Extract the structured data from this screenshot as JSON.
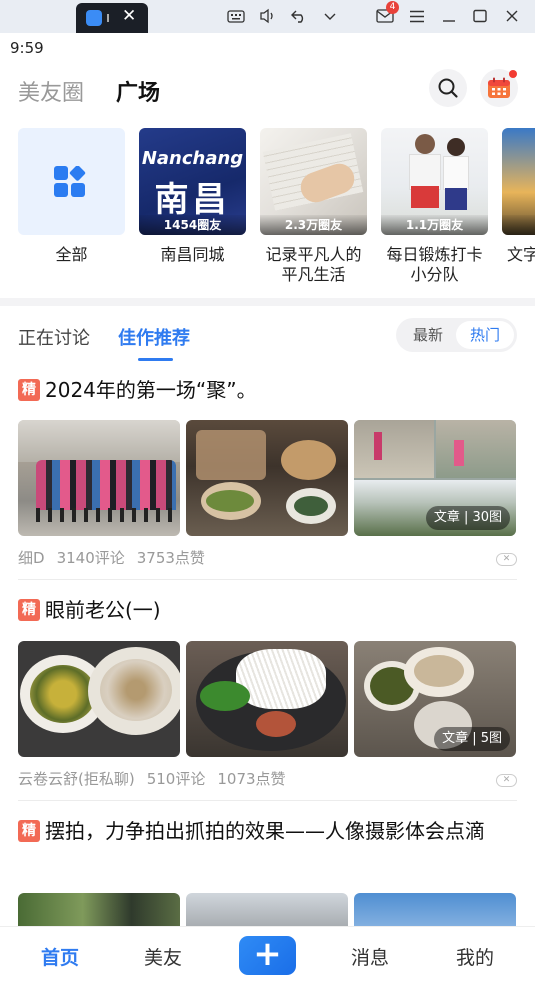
{
  "chrome": {
    "mail_badge": "4"
  },
  "status_bar": {
    "time": "9:59"
  },
  "header": {
    "tabs": [
      {
        "label": "美友圈",
        "active": false
      },
      {
        "label": "广场",
        "active": true
      }
    ],
    "icons": [
      "search-icon",
      "calendar-icon"
    ]
  },
  "circles": [
    {
      "name": "全部",
      "count": "",
      "icon": "grid-icon"
    },
    {
      "name": "南昌同城",
      "count": "1454圈友",
      "banner_en": "Nanchang",
      "banner_cn": "南昌"
    },
    {
      "name": "记录平凡人的平凡生活",
      "count": "2.3万圈友"
    },
    {
      "name": "每日锻炼打卡小分队",
      "count": "1.1万圈友"
    },
    {
      "name": "文字",
      "count": ""
    }
  ],
  "feed_tabs": {
    "tabs": [
      {
        "label": "正在讨论",
        "active": false
      },
      {
        "label": "佳作推荐",
        "active": true
      }
    ],
    "sort": [
      {
        "label": "最新",
        "active": false
      },
      {
        "label": "热门",
        "active": true
      }
    ]
  },
  "posts": [
    {
      "badge": "精",
      "title": "2024年的第一场“聚”。",
      "tag": "文章 | 30图",
      "author": "细D",
      "comments": "3140评论",
      "likes": "3753点赞"
    },
    {
      "badge": "精",
      "title": "眼前老公(一)",
      "tag": "文章 | 5图",
      "author": "云卷云舒(拒私聊)",
      "comments": "510评论",
      "likes": "1073点赞"
    },
    {
      "badge": "精",
      "title": "摆拍，力争拍出抓拍的效果——人像摄影体会点滴"
    }
  ],
  "bottom_nav": [
    {
      "label": "首页",
      "active": true
    },
    {
      "label": "美友",
      "active": false
    },
    {
      "label": "+",
      "active": false
    },
    {
      "label": "消息",
      "active": false
    },
    {
      "label": "我的",
      "active": false
    }
  ],
  "colors": {
    "accent": "#2f7bf0",
    "badge": "#f26a55",
    "dot": "#f23b32"
  }
}
